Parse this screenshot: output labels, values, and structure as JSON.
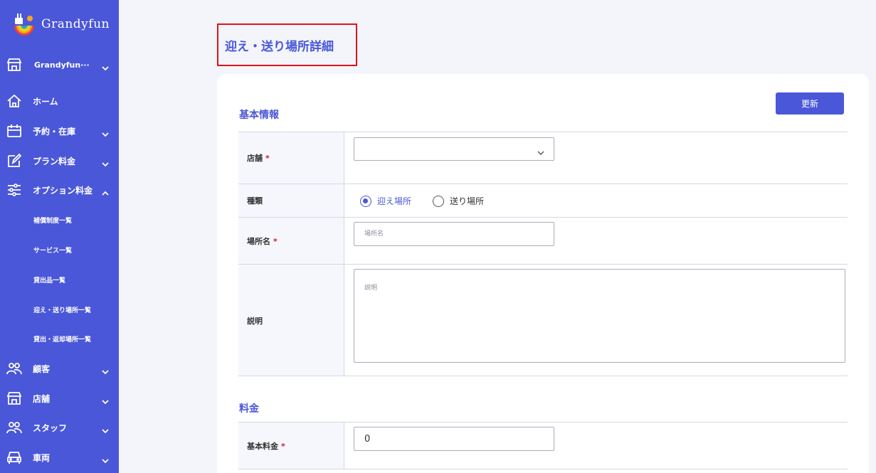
{
  "app": {
    "name": "Grandyfun"
  },
  "sidebar": {
    "store_selector": "Grandyfun···",
    "items": [
      {
        "label": "ホーム",
        "icon": "home-icon"
      },
      {
        "label": "予約・在庫",
        "icon": "calendar-icon"
      },
      {
        "label": "プラン料金",
        "icon": "edit-icon"
      },
      {
        "label": "オプション料金",
        "icon": "sliders-icon"
      },
      {
        "label": "顧客",
        "icon": "users-icon"
      },
      {
        "label": "店舗",
        "icon": "store-icon"
      },
      {
        "label": "スタッフ",
        "icon": "users-icon"
      },
      {
        "label": "車両",
        "icon": "car-icon"
      }
    ],
    "subitems": [
      "補償制度一覧",
      "サービス一覧",
      "貸出品一覧",
      "迎え・送り場所一覧",
      "貸出・返却場所一覧"
    ]
  },
  "page": {
    "title": "迎え・送り場所詳細"
  },
  "toolbar": {
    "update_label": "更新"
  },
  "basic_info": {
    "title": "基本情報",
    "store_label": "店舗",
    "required_mark": "*",
    "type_label": "種類",
    "type_options": [
      "迎え場所",
      "送り場所"
    ],
    "type_selected": "迎え場所",
    "place_label": "場所名",
    "place_placeholder": "場所名",
    "description_label": "説明",
    "description_placeholder": "説明"
  },
  "pricing": {
    "title": "料金",
    "base_price_label": "基本料金",
    "base_price_value": "0"
  },
  "colors": {
    "accent": "#4a57d8",
    "highlight": "#e0131b",
    "required": "#e0131b"
  }
}
